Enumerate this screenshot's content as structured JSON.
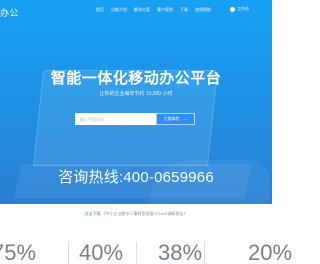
{
  "brand": {
    "name": "办公"
  },
  "nav": {
    "items": [
      "首页",
      "功能介绍",
      "解决方案",
      "客户案例",
      "下载",
      "使用帮助"
    ],
    "login_label": "工作台"
  },
  "hero": {
    "headline": "智能一体化移动办公平台",
    "subline": "让你的企业每年节约 10,000 小时",
    "input_placeholder": "输入手机号码",
    "try_button": "立即体验",
    "try_arrow": "→",
    "hotline": "咨询热线:400-0659966"
  },
  "section": {
    "title_link": "点击下载",
    "title_text": "《中小企业数字人事转型发展与SaaS调研报告》"
  },
  "stats": {
    "values": [
      "75%",
      "40%",
      "38%",
      "20%"
    ]
  }
}
